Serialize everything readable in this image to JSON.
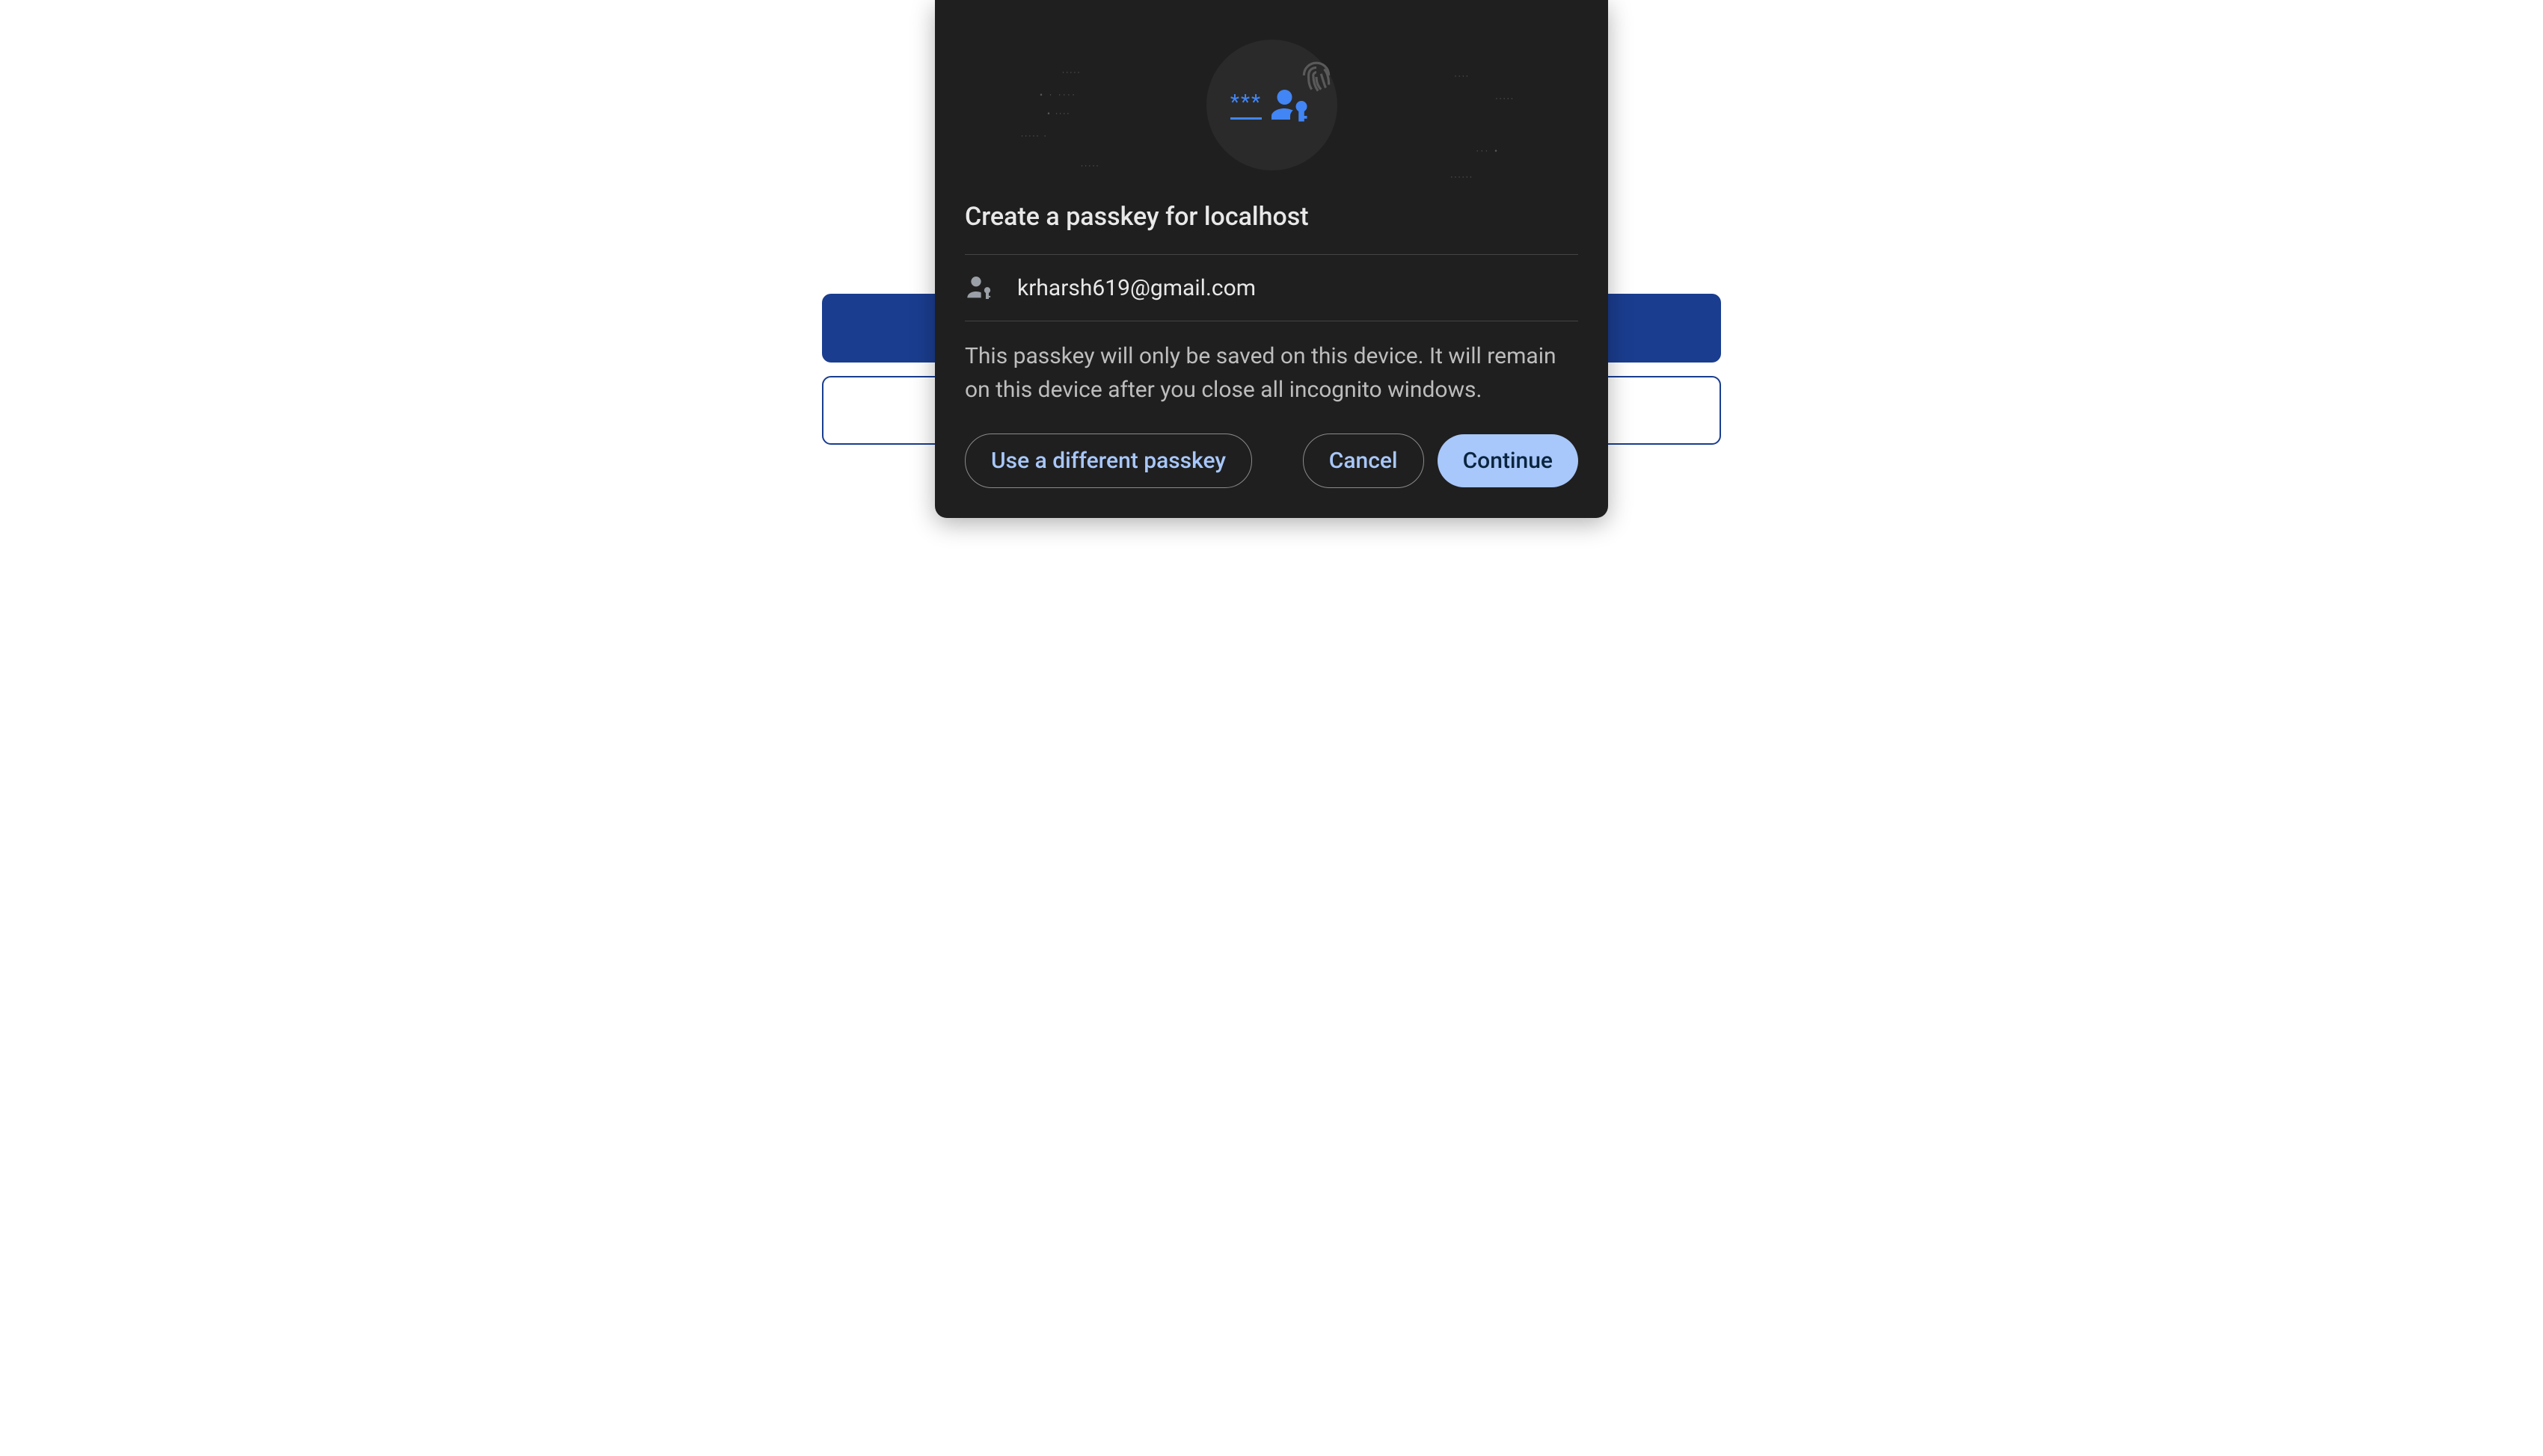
{
  "modal": {
    "title": "Create a passkey for localhost",
    "account": {
      "email": "krharsh619@gmail.com"
    },
    "description": "This passkey will only be saved on this device. It will remain on this device after you close all incognito windows.",
    "buttons": {
      "use_different": "Use a different passkey",
      "cancel": "Cancel",
      "continue": "Continue"
    }
  }
}
